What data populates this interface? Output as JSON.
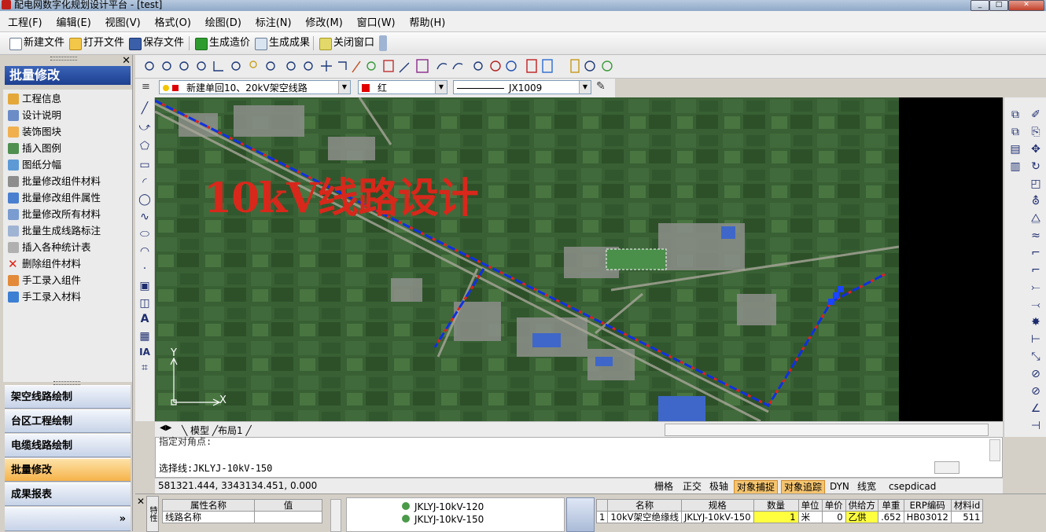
{
  "window": {
    "title": "配电网数字化规划设计平台 - [test]",
    "minimize": "_",
    "maximize": "□",
    "close": "✕"
  },
  "menu": [
    "工程(F)",
    "编辑(E)",
    "视图(V)",
    "格式(O)",
    "绘图(D)",
    "标注(N)",
    "修改(M)",
    "窗口(W)",
    "帮助(H)"
  ],
  "toolbar": {
    "new_file": "新建文件",
    "open_file": "打开文件",
    "save_file": "保存文件",
    "gen_cost": "生成造价",
    "gen_result": "生成成果",
    "close_window": "关闭窗口"
  },
  "panel": {
    "close": "✕",
    "header": "批量修改",
    "items": [
      "工程信息",
      "设计说明",
      "装饰图块",
      "插入图例",
      "图纸分幅",
      "批量修改组件材料",
      "批量修改组件属性",
      "批量修改所有材料",
      "批量生成线路标注",
      "插入各种统计表",
      "删除组件材料",
      "手工录入组件",
      "手工录入材料"
    ],
    "nav": [
      "架空线路绘制",
      "台区工程绘制",
      "电缆线路绘制",
      "批量修改",
      "成果报表"
    ],
    "nav_active": "批量修改",
    "expand": "»"
  },
  "layer": {
    "name": "新建单回10、20kV架空线路",
    "color_name": "红",
    "color": "#e00000",
    "linetype": "JX1009"
  },
  "canvas": {
    "title": "10kV线路设计",
    "ucs_y": "Y",
    "ucs_x": "X"
  },
  "tabs": {
    "model": "模型",
    "layout": "布局1"
  },
  "command": {
    "line1": "指定对角点:",
    "line2": "选择线:JKLYJ-10kV-150"
  },
  "status": {
    "coords": "581321.444,  3343134.451,  0.000",
    "buttons": [
      "栅格",
      "正交",
      "极轴",
      "对象捕捉",
      "对象追踪",
      "DYN",
      "线宽"
    ],
    "active": [
      "对象捕捉",
      "对象追踪"
    ],
    "app": "csepdicad"
  },
  "properties": {
    "side_label": "特性",
    "col_name": "属性名称",
    "col_value": "值",
    "row": "线路名称"
  },
  "tree": [
    "JKLYJ-10kV-120",
    "JKLYJ-10kV-150"
  ],
  "materials": {
    "headers": [
      "",
      "名称",
      "规格",
      "数量",
      "单位",
      "单价",
      "供给方",
      "单重",
      "ERP编码",
      "材料id"
    ],
    "rows": [
      [
        "1",
        "10kV架空绝缘线",
        "JKLYJ-10kV-150",
        "1",
        "米",
        "0",
        "乙供",
        ".652",
        "HB03012",
        "511"
      ]
    ]
  },
  "colors": {
    "accent": "#1d3f90",
    "highlight": "#f6b34a",
    "line_blue": "#1030e0",
    "line_red": "#e02020"
  }
}
